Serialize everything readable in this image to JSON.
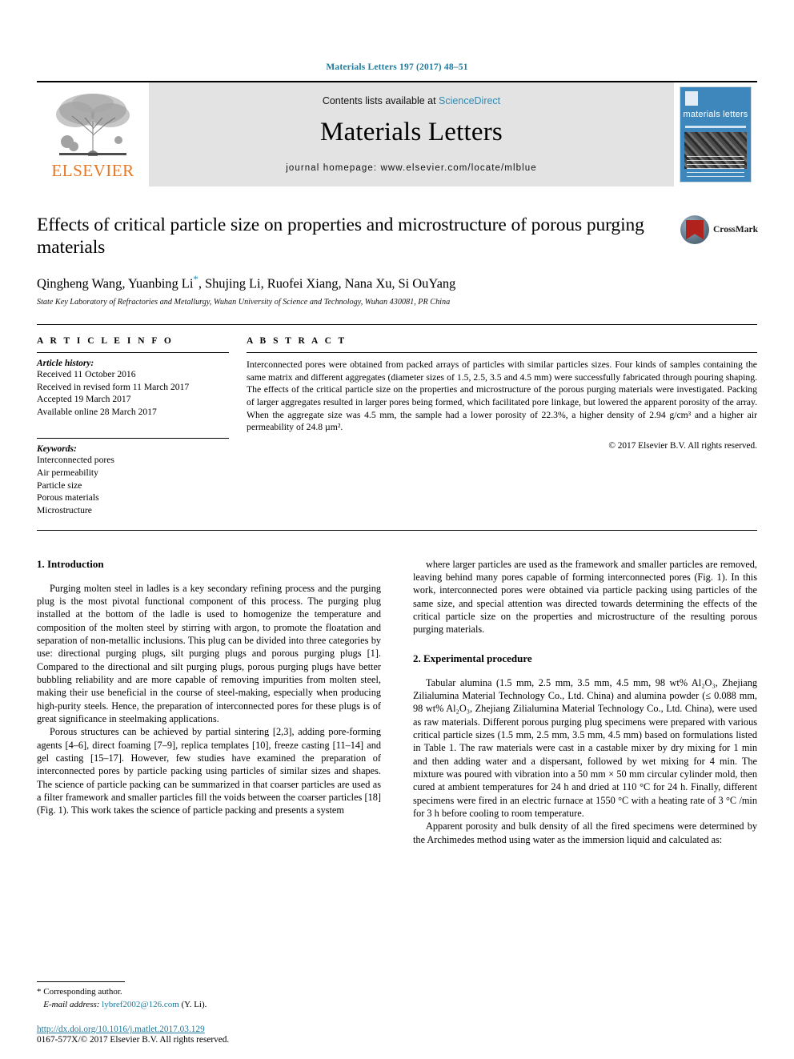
{
  "running_head": "Materials Letters 197 (2017) 48–51",
  "masthead": {
    "contents_prefix": "Contents lists available at ",
    "sciencedirect": "ScienceDirect",
    "journal_title": "Materials Letters",
    "homepage": "journal homepage: www.elsevier.com/locate/mlblue",
    "publisher_word": "ELSEVIER",
    "cover_title": "materials letters"
  },
  "article": {
    "title": "Effects of critical particle size on properties and microstructure of porous purging materials",
    "authors": "Qingheng Wang, Yuanbing Li",
    "authors_rest": ", Shujing Li, Ruofei Xiang, Nana Xu, Si OuYang",
    "corresponding_mark": "*",
    "affiliation": "State Key Laboratory of Refractories and Metallurgy, Wuhan University of Science and Technology, Wuhan 430081, PR China",
    "crossmark_label": "CrossMark"
  },
  "article_info": {
    "heading": "A R T I C L E  I N F O",
    "history_label": "Article history:",
    "history": [
      "Received 11 October 2016",
      "Received in revised form 11 March 2017",
      "Accepted 19 March 2017",
      "Available online 28 March 2017"
    ],
    "keywords_label": "Keywords:",
    "keywords": [
      "Interconnected pores",
      "Air permeability",
      "Particle size",
      "Porous materials",
      "Microstructure"
    ]
  },
  "abstract": {
    "heading": "A B S T R A C T",
    "text": "Interconnected pores were obtained from packed arrays of particles with similar particles sizes. Four kinds of samples containing the same matrix and different aggregates (diameter sizes of 1.5, 2.5, 3.5 and 4.5 mm) were successfully fabricated through pouring shaping. The effects of the critical particle size on the properties and microstructure of the porous purging materials were investigated. Packing of larger aggregates resulted in larger pores being formed, which facilitated pore linkage, but lowered the apparent porosity of the array. When the aggregate size was 4.5 mm, the sample had a lower porosity of 22.3%, a higher density of 2.94 g/cm³ and a higher air permeability of 24.8 µm².",
    "copyright": "© 2017 Elsevier B.V. All rights reserved."
  },
  "sections": {
    "introduction_title": "1. Introduction",
    "intro_p1": "Purging molten steel in ladles is a key secondary refining process and the purging plug is the most pivotal functional component of this process. The purging plug installed at the bottom of the ladle is used to homogenize the temperature and composition of the molten steel by stirring with argon, to promote the floatation and separation of non-metallic inclusions. This plug can be divided into three categories by use: directional purging plugs, silt purging plugs and porous purging plugs [1]. Compared to the directional and silt purging plugs, porous purging plugs have better bubbling reliability and are more capable of removing impurities from molten steel, making their use beneficial in the course of steel-making, especially when producing high-purity steels. Hence, the preparation of interconnected pores for these plugs is of great significance in steelmaking applications.",
    "intro_p2": "Porous structures can be achieved by partial sintering [2,3], adding pore-forming agents [4–6], direct foaming [7–9], replica templates [10], freeze casting [11–14] and gel casting [15–17]. However, few studies have examined the preparation of interconnected pores by particle packing using particles of similar sizes and shapes. The science of particle packing can be summarized in that coarser particles are used as a filter framework and smaller particles fill the voids between the coarser particles [18] (Fig. 1). This work takes the science of particle packing and presents a system",
    "intro_p3": "where larger particles are used as the framework and smaller particles are removed, leaving behind many pores capable of forming interconnected pores (Fig. 1). In this work, interconnected pores were obtained via particle packing using particles of the same size, and special attention was directed towards determining the effects of the critical particle size on the properties and microstructure of the resulting porous purging materials.",
    "experimental_title": "2. Experimental procedure",
    "exp_p1": "Tabular alumina (1.5 mm, 2.5 mm, 3.5 mm, 4.5 mm, 98 wt% Al₂O₃, Zhejiang Zilialumina Material Technology Co., Ltd. China) and alumina powder (≤ 0.088 mm, 98 wt% Al₂O₃, Zhejiang Zilialumina Material Technology Co., Ltd. China), were used as raw materials. Different porous purging plug specimens were prepared with various critical particle sizes (1.5 mm, 2.5 mm, 3.5 mm, 4.5 mm) based on formulations listed in Table 1. The raw materials were cast in a castable mixer by dry mixing for 1 min and then adding water and a dispersant, followed by wet mixing for 4 min. The mixture was poured with vibration into a 50 mm × 50 mm circular cylinder mold, then cured at ambient temperatures for 24 h and dried at 110 °C for 24 h. Finally, different specimens were fired in an electric furnace at 1550 °C with a heating rate of 3 °C /min for 3 h before cooling to room temperature.",
    "exp_p2": "Apparent porosity and bulk density of all the fired specimens were determined by the Archimedes method using water as the immersion liquid and calculated as:"
  },
  "footnote": {
    "corresponding": "* Corresponding author.",
    "email_label": "E-mail address:",
    "email": "lybref2002@126.com",
    "email_owner": "(Y. Li).",
    "doi": "http://dx.doi.org/10.1016/j.matlet.2017.03.129",
    "issn": "0167-577X/© 2017 Elsevier B.V. All rights reserved."
  },
  "colors": {
    "link": "#1f7a9c",
    "elsevier_orange": "#E87722",
    "cover_blue": "#3d87bd"
  }
}
